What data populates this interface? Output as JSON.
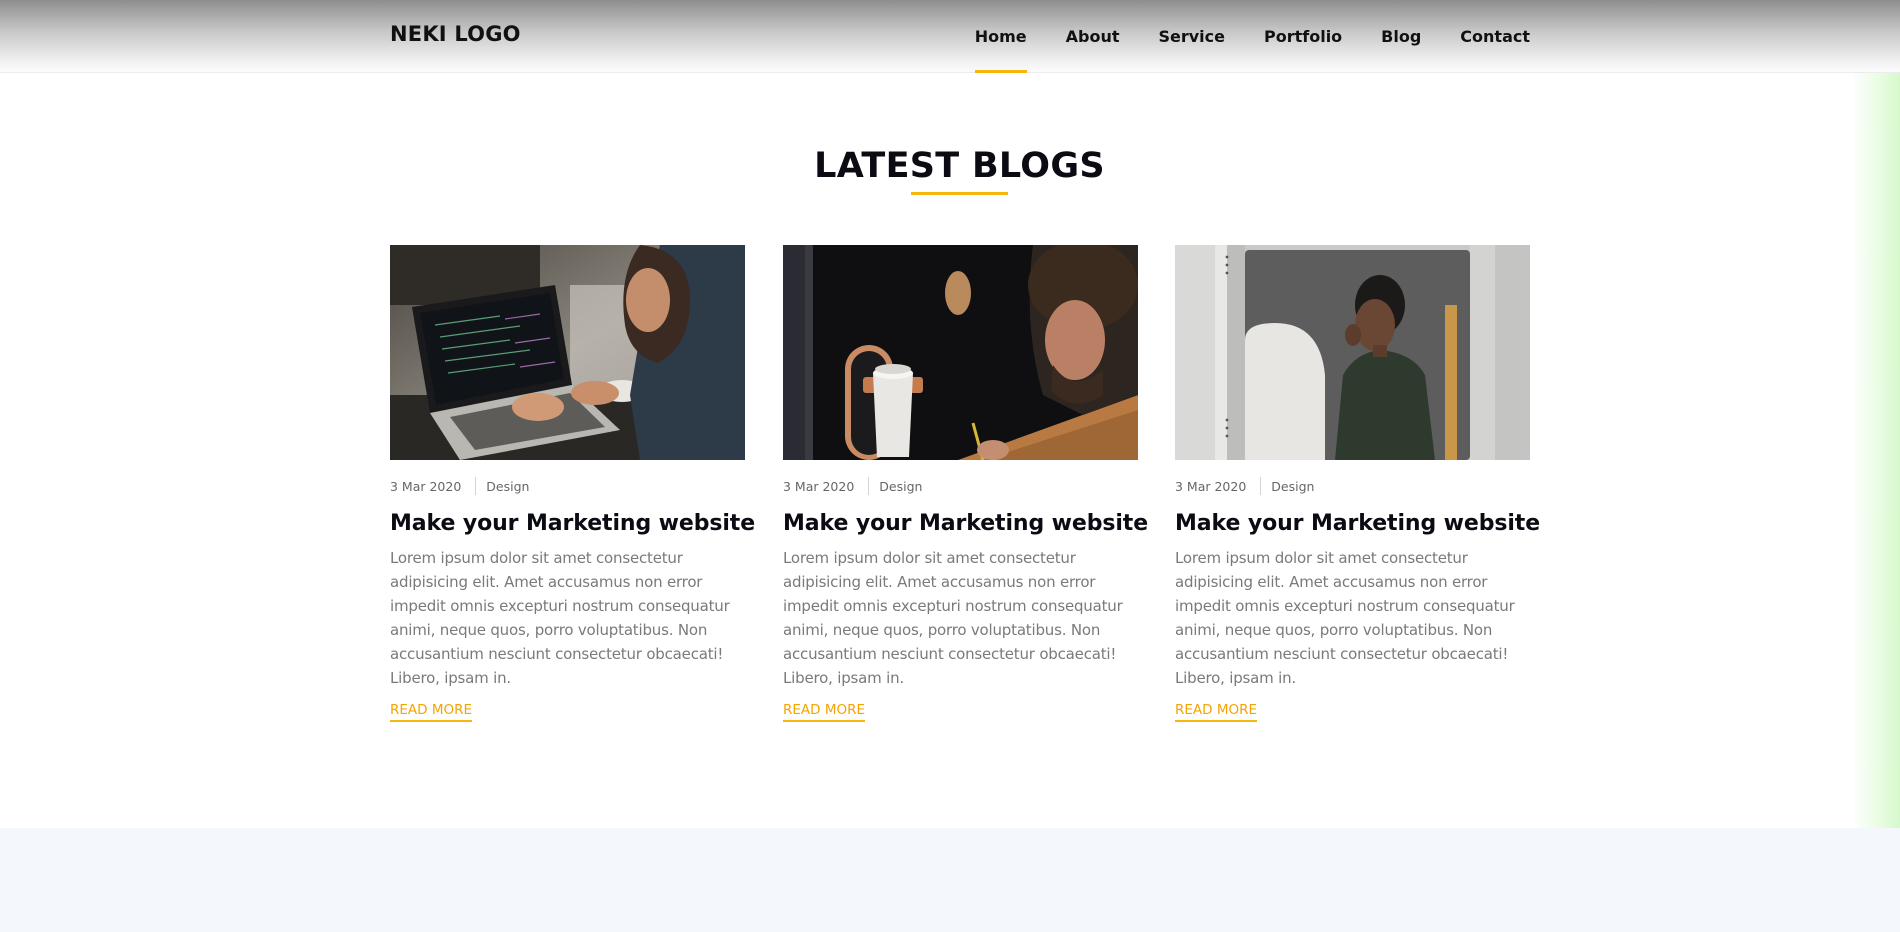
{
  "header": {
    "logo": "NEKI LOGO",
    "nav": [
      {
        "label": "Home",
        "active": true
      },
      {
        "label": "About",
        "active": false
      },
      {
        "label": "Service",
        "active": false
      },
      {
        "label": "Portfolio",
        "active": false
      },
      {
        "label": "Blog",
        "active": false
      },
      {
        "label": "Contact",
        "active": false
      }
    ]
  },
  "section": {
    "title": "LATEST BLOGS"
  },
  "blogs": [
    {
      "date": "3 Mar 2020",
      "category": "Design",
      "title": "Make your Marketing website",
      "excerpt": "Lorem ipsum dolor sit amet consectetur adipisicing elit. Amet accusamus non error impedit omnis excepturi nostrum consequatur animi, neque quos, porro voluptatibus. Non accusantium nesciunt consectetur obcaecati! Libero, ipsam in.",
      "read_more": "READ MORE",
      "image": "person-coding-on-laptop"
    },
    {
      "date": "3 Mar 2020",
      "category": "Design",
      "title": "Make your Marketing website",
      "excerpt": "Lorem ipsum dolor sit amet consectetur adipisicing elit. Amet accusamus non error impedit omnis excepturi nostrum consequatur animi, neque quos, porro voluptatibus. Non accusantium nesciunt consectetur obcaecati! Libero, ipsam in.",
      "read_more": "READ MORE",
      "image": "person-writing-with-coffee-cup"
    },
    {
      "date": "3 Mar 2020",
      "category": "Design",
      "title": "Make your Marketing website",
      "excerpt": "Lorem ipsum dolor sit amet consectetur adipisicing elit. Amet accusamus non error impedit omnis excepturi nostrum consequatur animi, neque quos, porro voluptatibus. Non accusantium nesciunt consectetur obcaecati! Libero, ipsam in.",
      "read_more": "READ MORE",
      "image": "person-on-phone-in-booth"
    }
  ],
  "colors": {
    "accent": "#f7b60c",
    "heading": "#0b0b14",
    "body_text": "#7a7a7a",
    "footer_band": "#f4f7fb"
  }
}
